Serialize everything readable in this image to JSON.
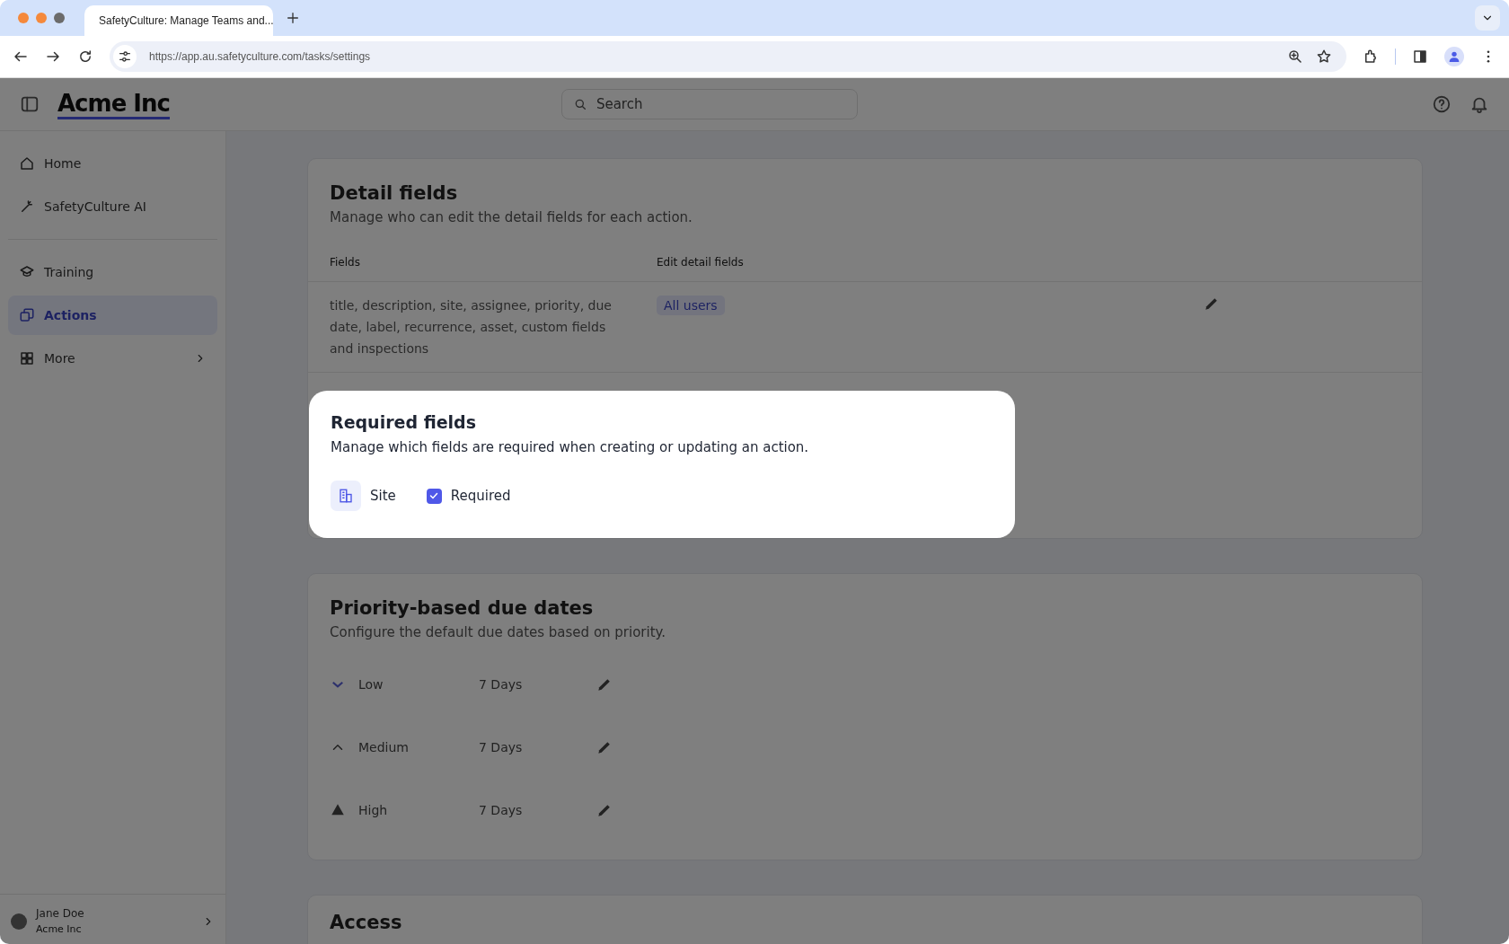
{
  "browser": {
    "tabs": [
      {
        "title": "SafetyCulture: Manage Teams and...",
        "selected": true
      }
    ],
    "url": "https://app.au.safetyculture.com/tasks/settings"
  },
  "app": {
    "logo": "Acme Inc",
    "search": {
      "placeholder": "Search"
    }
  },
  "sidebar": {
    "sections": [
      {
        "items": [
          {
            "label": "Home",
            "kind": "home",
            "selected": false
          },
          {
            "label": "SafetyCulture AI",
            "kind": "ai",
            "selected": false
          }
        ]
      },
      {
        "items": [
          {
            "label": "Training",
            "kind": "training",
            "selected": false
          },
          {
            "label": "Actions",
            "kind": "actions",
            "selected": true
          },
          {
            "label": "More",
            "kind": "more",
            "selected": false
          }
        ]
      }
    ],
    "user": {
      "name": "Jane Doe",
      "org": "Acme Inc"
    }
  },
  "detail_fields": {
    "title": "Detail fields",
    "description": "Manage who can edit the detail fields for each action.",
    "columns": [
      "Fields",
      "Edit detail fields"
    ],
    "rows": [
      {
        "fields": "title, description, site, assignee, priority, due date, label, recurrence, asset, custom fields and inspections",
        "access": "All users"
      }
    ]
  },
  "required_fields": {
    "title": "Required fields",
    "description": "Manage which fields are required when creating or updating an action.",
    "fields": [
      {
        "label": "Site",
        "checkbox": {
          "label": "Required",
          "checked": true
        }
      }
    ]
  },
  "priority_due_dates": {
    "title": "Priority-based due dates",
    "description": "Configure the default due dates based on priority.",
    "rows": [
      {
        "label": "Low",
        "kind": "low",
        "duration": "7 Days"
      },
      {
        "label": "Medium",
        "kind": "medium",
        "duration": "7 Days"
      },
      {
        "label": "High",
        "kind": "high",
        "duration": "7 Days"
      }
    ]
  },
  "access": {
    "title": "Access"
  }
}
